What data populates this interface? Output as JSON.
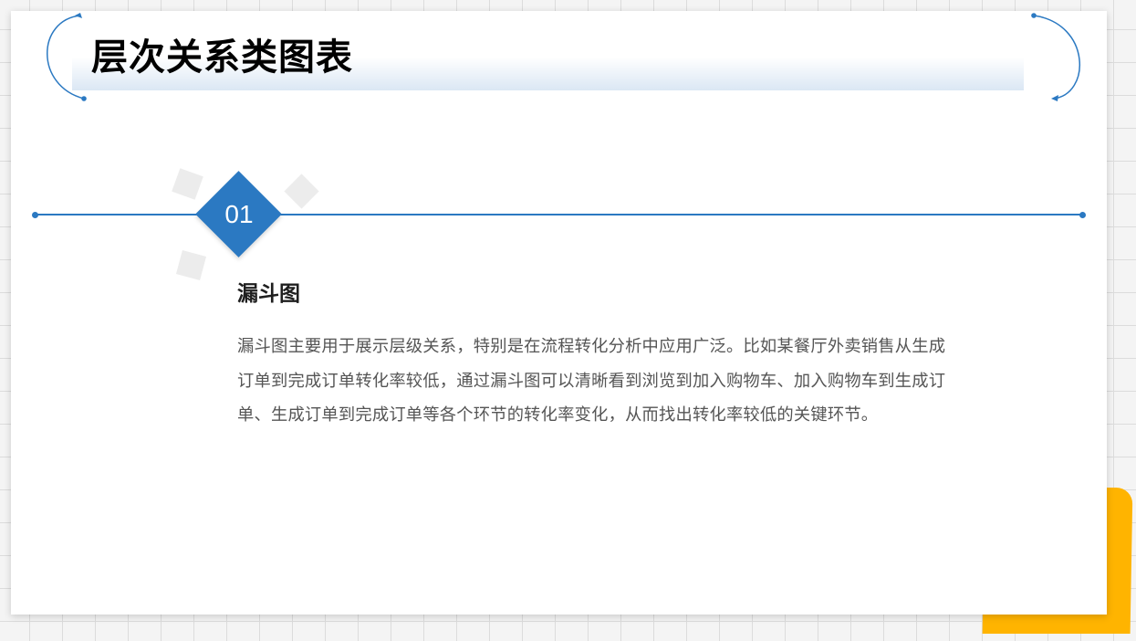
{
  "slide": {
    "title": "层次关系类图表"
  },
  "section": {
    "number": "01",
    "heading": "漏斗图",
    "body": "漏斗图主要用于展示层级关系，特别是在流程转化分析中应用广泛。比如某餐厅外卖销售从生成订单到完成订单转化率较低，通过漏斗图可以清晰看到浏览到加入购物车、加入购物车到生成订单、生成订单到完成订单等各个环节的转化率变化，从而找出转化率较低的关键环节。"
  },
  "colors": {
    "accent_blue": "#2b79c2",
    "accent_yellow": "#ffb400",
    "title_band": "#dbe7f4"
  }
}
